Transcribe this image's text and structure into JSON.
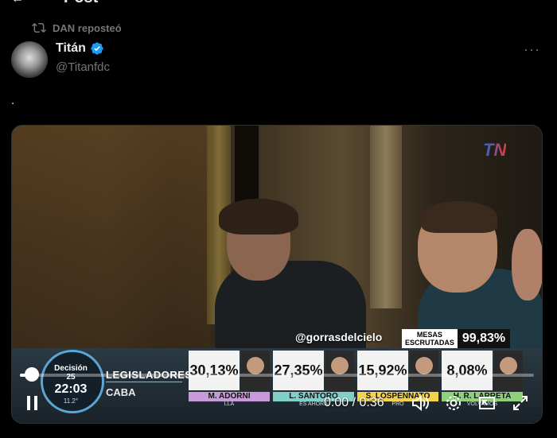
{
  "header": {
    "title": "Post"
  },
  "repost": {
    "text": "DAN reposteó"
  },
  "author": {
    "name": "Titán",
    "handle": "@Titanfdc"
  },
  "post": {
    "text": "."
  },
  "video": {
    "channel_logo": "TN",
    "source_tag": "@gorrasdelcielo",
    "mesas": {
      "label_line1": "MESAS",
      "label_line2": "ESCRUTADAS",
      "value": "99,83%"
    },
    "decision": {
      "label": "Decisión 25",
      "time": "22:03",
      "temp": "11.2°"
    },
    "category": {
      "line1": "LEGISLADORES",
      "line2": "CABA"
    },
    "candidates": [
      {
        "pct": "30,13%",
        "name": "M. ADORNI",
        "party": "LLA"
      },
      {
        "pct": "27,35%",
        "name": "L. SANTORO",
        "party": "ES AHORA"
      },
      {
        "pct": "15,92%",
        "name": "S. LOSPENNATO",
        "party": "PRO"
      },
      {
        "pct": "8,08%",
        "name": "H. R. LARRETA",
        "party": "VOLVAMOS"
      }
    ],
    "playback": {
      "current": "0:00",
      "separator": "/",
      "duration": "0:36",
      "progress": 0.0
    }
  },
  "icons": [
    "back-arrow-icon",
    "repost-icon",
    "verified-icon",
    "more-icon",
    "pause-icon",
    "volume-icon",
    "settings-icon",
    "pip-icon",
    "fullscreen-icon"
  ],
  "colors": {
    "verified": "#1d9bf0",
    "muted_text": "#71767b",
    "text": "#e7e9ea"
  }
}
